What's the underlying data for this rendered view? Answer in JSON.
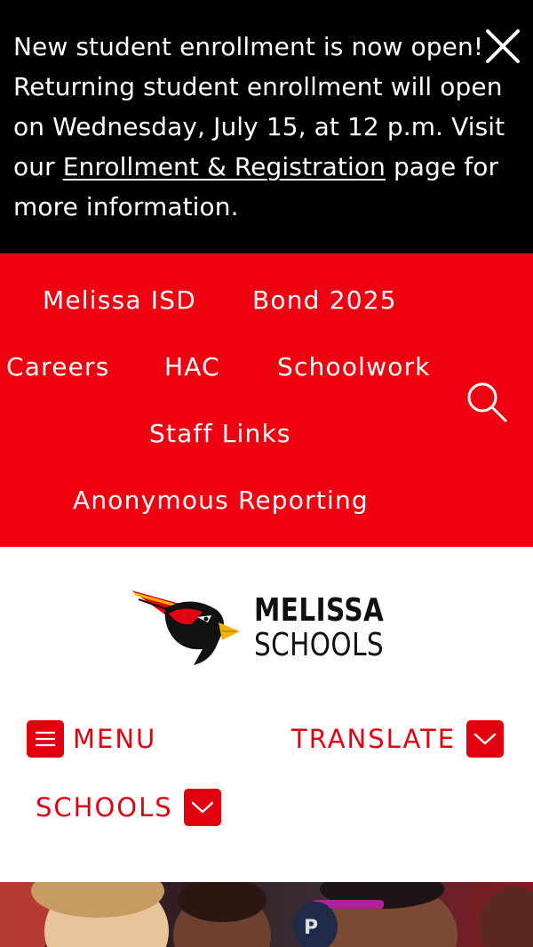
{
  "alert": {
    "text_before_link": "New student enrollment is now open! Returning student enrollment will open on Wednesday, July 15, at 12 p.m. Visit our ",
    "link_text": "Enrollment & Registration",
    "text_after_link": " page for more information.",
    "close_icon": "close-icon"
  },
  "quicklinks": {
    "items": [
      "Melissa ISD",
      "Bond 2025",
      "Careers",
      "HAC",
      "Schoolwork",
      "Staff Links",
      "Anonymous Reporting"
    ],
    "search_icon": "search-icon"
  },
  "logo": {
    "line1": "MELISSA",
    "line2": "SCHOOLS",
    "mark": "cardinal-logo"
  },
  "nav": {
    "menu_label": "MENU",
    "translate_label": "TRANSLATE",
    "schools_label": "SCHOOLS"
  },
  "colors": {
    "alert_bg": "#000000",
    "quicklinks_bg": "#ee0011",
    "accent": "#e10010",
    "text_light": "#ffffff",
    "text_dark": "#111111"
  }
}
